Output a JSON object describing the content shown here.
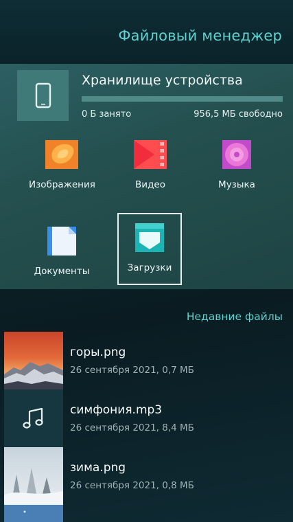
{
  "header": {
    "title": "Файловый менеджер"
  },
  "storage": {
    "title": "Хранилище устройства",
    "used": "0 Б занято",
    "free": "956,5 МБ свободно",
    "used_fraction": 0.0
  },
  "categories": [
    {
      "label": "Изображения",
      "icon": "images-icon"
    },
    {
      "label": "Видео",
      "icon": "video-icon"
    },
    {
      "label": "Музыка",
      "icon": "music-disc-icon"
    },
    {
      "label": "Документы",
      "icon": "document-icon"
    },
    {
      "label": "Загрузки",
      "icon": "downloads-icon"
    }
  ],
  "recent": {
    "title": "Недавние файлы",
    "files": [
      {
        "name": "горы.png",
        "meta": "26 сентября 2021, 0,7 МБ",
        "thumb": "mountains-image"
      },
      {
        "name": "симфония.mp3",
        "meta": "26 сентября 2021, 8,4 МБ",
        "thumb": "music-note-icon"
      },
      {
        "name": "зима.png",
        "meta": "26 сентября 2021, 0,8 МБ",
        "thumb": "winter-image"
      }
    ]
  },
  "colors": {
    "accent": "#5fd3cf",
    "panel": "#24504f",
    "background": "#0c2229"
  }
}
